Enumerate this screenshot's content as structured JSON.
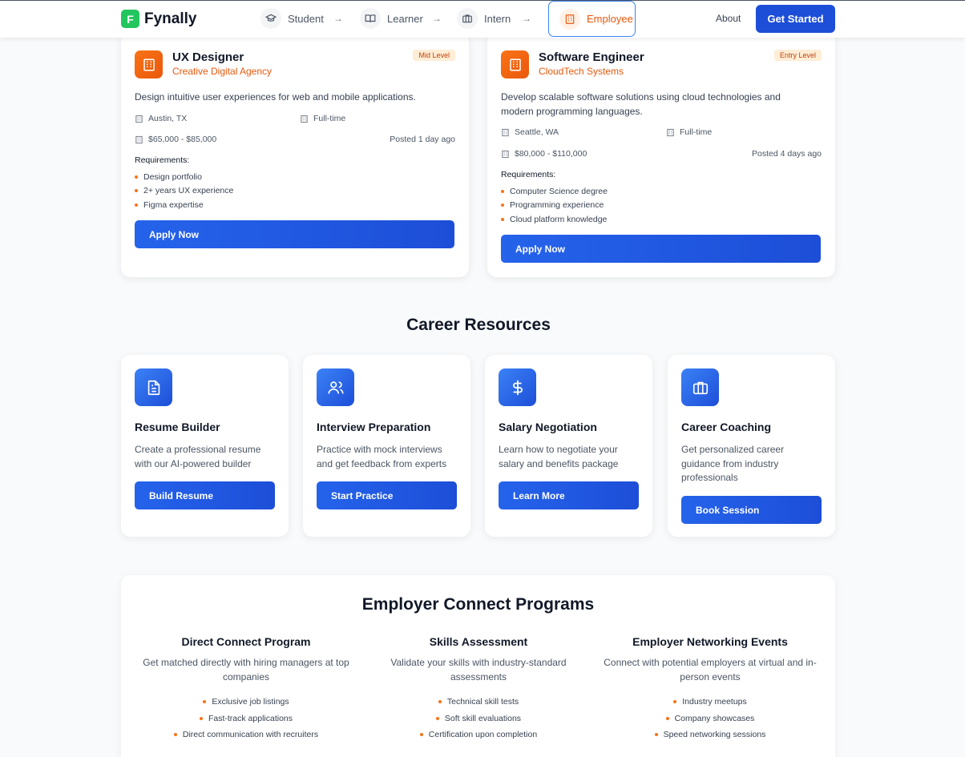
{
  "header": {
    "logo_letter": "F",
    "brand": "Fynally",
    "nav": [
      {
        "label": "Student",
        "icon": "graduation-cap-icon"
      },
      {
        "label": "Learner",
        "icon": "book-open-icon"
      },
      {
        "label": "Intern",
        "icon": "briefcase-icon"
      },
      {
        "label": "Employee",
        "icon": "building-icon"
      }
    ],
    "nav_arrow": "→",
    "about": "About",
    "cta": "Get Started"
  },
  "jobs": [
    {
      "title": "UX Designer",
      "company": "Creative Digital Agency",
      "level": "Mid Level",
      "description": "Design intuitive user experiences for web and mobile applications.",
      "location": "Austin, TX",
      "type": "Full-time",
      "salary": "$65,000 - $85,000",
      "posted": "Posted 1 day ago",
      "requirements_title": "Requirements:",
      "requirements": [
        "Design portfolio",
        "2+ years UX experience",
        "Figma expertise"
      ],
      "apply": "Apply Now"
    },
    {
      "title": "Software Engineer",
      "company": "CloudTech Systems",
      "level": "Entry Level",
      "description": "Develop scalable software solutions using cloud technologies and modern programming languages.",
      "location": "Seattle, WA",
      "type": "Full-time",
      "salary": "$80,000 - $110,000",
      "posted": "Posted 4 days ago",
      "requirements_title": "Requirements:",
      "requirements": [
        "Computer Science degree",
        "Programming experience",
        "Cloud platform knowledge"
      ],
      "apply": "Apply Now"
    }
  ],
  "resources": {
    "title": "Career Resources",
    "items": [
      {
        "title": "Resume Builder",
        "description": "Create a professional resume with our AI-powered builder",
        "button": "Build Resume",
        "icon": "document-icon"
      },
      {
        "title": "Interview Preparation",
        "description": "Practice with mock interviews and get feedback from experts",
        "button": "Start Practice",
        "icon": "users-icon"
      },
      {
        "title": "Salary Negotiation",
        "description": "Learn how to negotiate your salary and benefits package",
        "button": "Learn More",
        "icon": "dollar-icon"
      },
      {
        "title": "Career Coaching",
        "description": "Get personalized career guidance from industry professionals",
        "button": "Book Session",
        "icon": "briefcase-icon"
      }
    ]
  },
  "programs": {
    "title": "Employer Connect Programs",
    "items": [
      {
        "title": "Direct Connect Program",
        "description": "Get matched directly with hiring managers at top companies",
        "bullets": [
          "Exclusive job listings",
          "Fast-track applications",
          "Direct communication with recruiters"
        ]
      },
      {
        "title": "Skills Assessment",
        "description": "Validate your skills with industry-standard assessments",
        "bullets": [
          "Technical skill tests",
          "Soft skill evaluations",
          "Certification upon completion"
        ]
      },
      {
        "title": "Employer Networking Events",
        "description": "Connect with potential employers at virtual and in-person events",
        "bullets": [
          "Industry meetups",
          "Company showcases",
          "Speed networking sessions"
        ]
      }
    ]
  },
  "colors": {
    "accent_blue": "#1d4ed8",
    "accent_orange": "#ea580c",
    "logo_green": "#22c55e"
  }
}
